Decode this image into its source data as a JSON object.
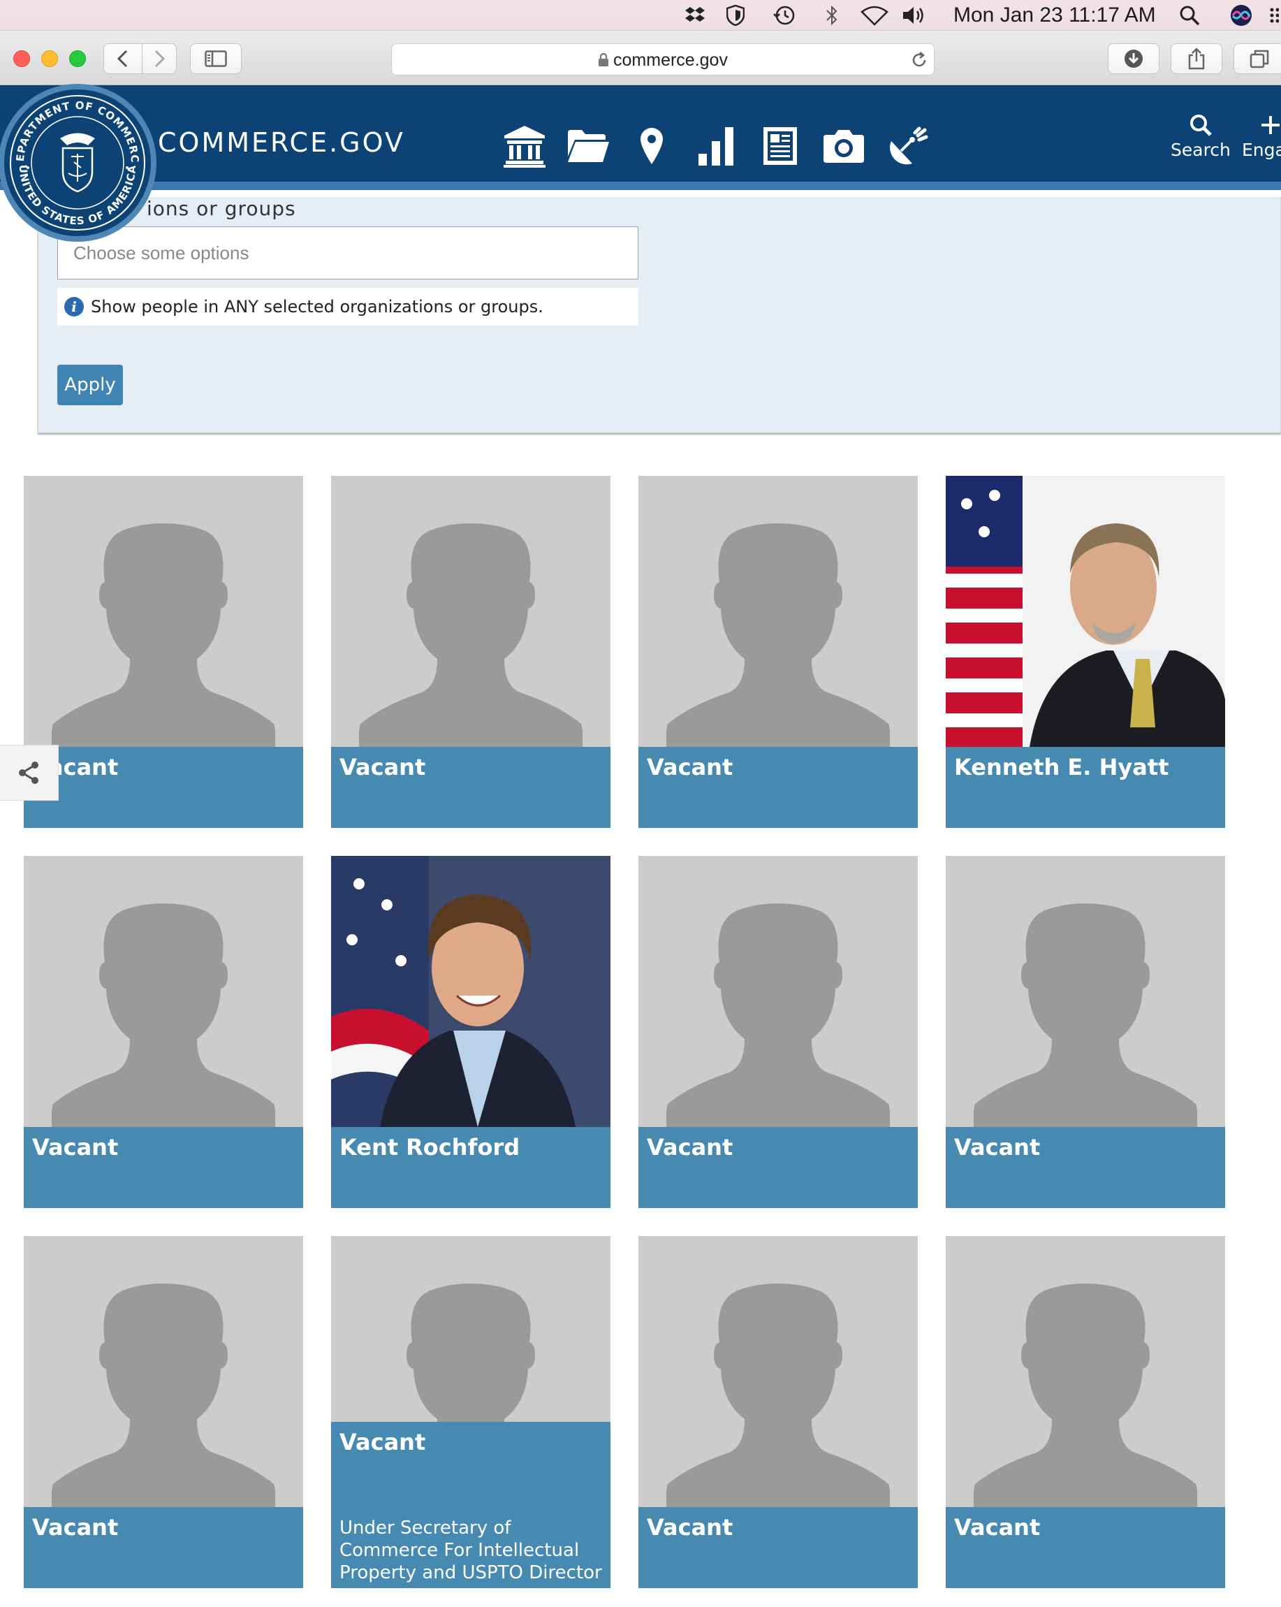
{
  "menubar": {
    "clock": "Mon Jan 23  11:17 AM",
    "icons": [
      "dropbox-icon",
      "shield-icon",
      "time-machine-icon",
      "bluetooth-icon",
      "wifi-icon",
      "volume-icon",
      "spotlight-icon",
      "siri-icon",
      "menu-extras-icon"
    ]
  },
  "browser": {
    "url": "commerce.gov",
    "icons": [
      "back-icon",
      "forward-icon",
      "sidebar-icon",
      "lock-icon",
      "reload-icon",
      "download-icon",
      "share-icon",
      "tabs-icon"
    ]
  },
  "header": {
    "site_title": "COMMERCE.GOV",
    "nav_icons": [
      "bank-icon",
      "folder-icon",
      "map-pin-icon",
      "bar-chart-icon",
      "newspaper-icon",
      "camera-icon",
      "satellite-dish-icon"
    ],
    "search_label": "Search",
    "engage_label": "Enga",
    "seal_text_top": "DEPARTMENT OF COMMERCE",
    "seal_text_bottom": "UNITED STATES OF AMERICA"
  },
  "filter": {
    "label": "ions or groups",
    "select_placeholder": "Choose some options",
    "help_text": "Show people in ANY selected organizations or groups.",
    "apply_label": "Apply"
  },
  "people": [
    {
      "name": "Vacant",
      "photo": "placeholder"
    },
    {
      "name": "Vacant",
      "photo": "placeholder"
    },
    {
      "name": "Vacant",
      "photo": "placeholder"
    },
    {
      "name": "Kenneth E. Hyatt",
      "photo": "portrait"
    },
    {
      "name": "Vacant",
      "photo": "placeholder"
    },
    {
      "name": "Kent Rochford",
      "photo": "portrait"
    },
    {
      "name": "Vacant",
      "photo": "placeholder"
    },
    {
      "name": "Vacant",
      "photo": "placeholder"
    },
    {
      "name": "Vacant",
      "photo": "placeholder"
    },
    {
      "name": "Vacant",
      "photo": "placeholder",
      "subtitle": "Under Secretary of Commerce For Intellectual Property and USPTO Director"
    },
    {
      "name": "Vacant",
      "photo": "placeholder"
    },
    {
      "name": "Vacant",
      "photo": "placeholder"
    }
  ],
  "colors": {
    "header_bg": "#0d4274",
    "header_stripe": "#3a7ab0",
    "card_bar": "#4689b1",
    "card_photo_bg": "#cccccc",
    "silhouette": "#9a9a9a",
    "apply_bg": "#3f84b2"
  }
}
